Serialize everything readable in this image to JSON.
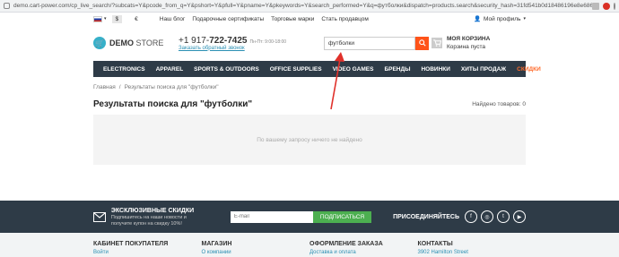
{
  "browser": {
    "url": "demo.cart-power.com/cp_live_search/?subcats=Y&pcode_from_q=Y&pshort=Y&pfull=Y&pname=Y&pkeywords=Y&search_performed=Y&q=футболки&dispatch=products.search&security_hash=31fd541b0d18486196e8e686b54f47ec"
  },
  "topbar": {
    "currencies": [
      "$",
      "€"
    ],
    "links": [
      "Наш блог",
      "Подарочные сертификаты",
      "Торговые марки",
      "Стать продавцом"
    ],
    "profile": "Мой профиль"
  },
  "header": {
    "logo_bold": "DEMO",
    "logo_light": "STORE",
    "phone_prefix": "+1 917-",
    "phone_main": "722-7425",
    "hours": "Пн-Пт: 9:00-18:00",
    "callback": "Заказать обратный звонок",
    "search_value": "футболки",
    "cart_title": "МОЯ КОРЗИНА",
    "cart_status": "Корзина пуста"
  },
  "nav": {
    "items": [
      "ELECTRONICS",
      "APPAREL",
      "SPORTS & OUTDOORS",
      "OFFICE SUPPLIES",
      "VIDEO GAMES",
      "БРЕНДЫ",
      "НОВИНКИ",
      "ХИТЫ ПРОДАЖ"
    ],
    "sale": "СКИДКИ"
  },
  "breadcrumbs": {
    "home": "Главная",
    "sep": "/",
    "current": "Результаты поиска для \"футболки\""
  },
  "results": {
    "title": "Результаты поиска для \"футболки\"",
    "found": "Найдено товаров: 0",
    "empty": "По вашему запросу ничего не найдено"
  },
  "subscribe": {
    "title": "ЭКСКЛЮЗИВНЫЕ СКИДКИ",
    "desc1": "Подпишитесь на наши новости и",
    "desc2": "получите купон на скидку 10%!",
    "placeholder": "E-mail",
    "button": "ПОДПИСАТЬСЯ",
    "join": "ПРИСОЕДИНЯЙТЕСЬ"
  },
  "footer": {
    "cols": [
      {
        "head": "КАБИНЕТ ПОКУПАТЕЛЯ",
        "link": "Войти"
      },
      {
        "head": "МАГАЗИН",
        "link": "О компании"
      },
      {
        "head": "ОФОРМЛЕНИЕ ЗАКАЗА",
        "link": "Доставка и оплата"
      },
      {
        "head": "КОНТАКТЫ",
        "link": "3902 Hamilton Street"
      }
    ]
  },
  "colors": {
    "accent": "#ff5319",
    "nav_bg": "#2e3b47",
    "logo": "#36b0c9",
    "annotation_arrow": "#e0312b"
  }
}
